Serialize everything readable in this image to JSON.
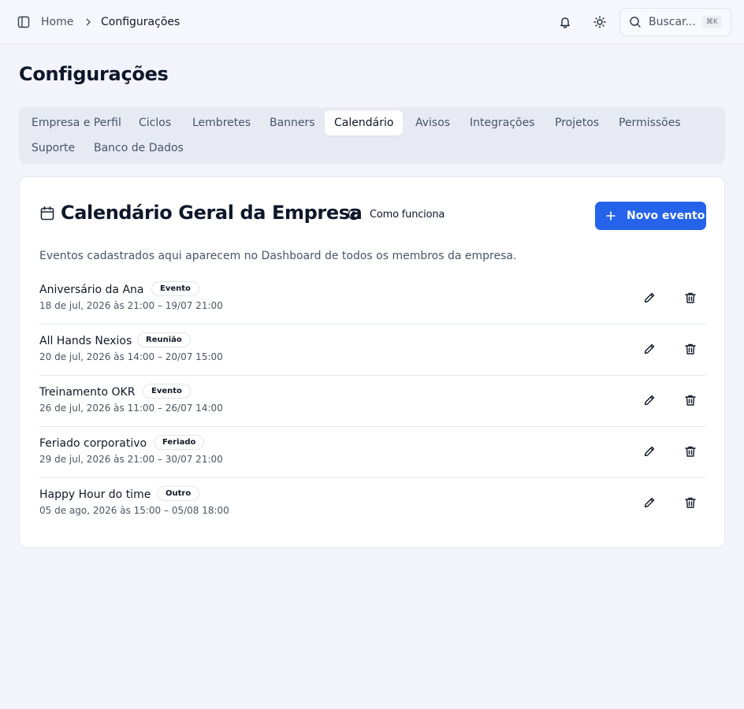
{
  "breadcrumb": {
    "home": "Home",
    "current": "Configurações"
  },
  "search": {
    "label": "Buscar...",
    "shortcut": "⌘K"
  },
  "page": {
    "title": "Configurações"
  },
  "tabs": [
    "Empresa e Perfil",
    "Ciclos",
    "Lembretes",
    "Banners",
    "Calendário",
    "Avisos",
    "Integrações",
    "Projetos",
    "Permissões",
    "Suporte",
    "Banco de Dados"
  ],
  "active_tab": "Calendário",
  "card": {
    "title": "Calendário Geral da Empresa",
    "how_label": "Como funciona",
    "new_button": "Novo evento",
    "description": "Eventos cadastrados aqui aparecem no Dashboard de todos os membros da empresa."
  },
  "events": [
    {
      "title": "Aniversário da Ana",
      "badge": "Evento",
      "date": "18 de jul, 2026 às 21:00 – 19/07 21:00"
    },
    {
      "title": "All Hands Nexios",
      "badge": "Reunião",
      "date": "20 de jul, 2026 às 14:00 – 20/07 15:00"
    },
    {
      "title": "Treinamento OKR",
      "badge": "Evento",
      "date": "26 de jul, 2026 às 11:00 – 26/07 14:00"
    },
    {
      "title": "Feriado corporativo",
      "badge": "Feriado",
      "date": "29 de jul, 2026 às 21:00 – 30/07 21:00"
    },
    {
      "title": "Happy Hour do time",
      "badge": "Outro",
      "date": "05 de ago, 2026 às 15:00 – 05/08 18:00"
    }
  ],
  "colors": {
    "accent": "#2563eb",
    "background": "#f3f4fb",
    "text": "#0f172a"
  },
  "icons": [
    "sidebar-toggle-icon",
    "chevron-right-icon",
    "bell-icon",
    "sun-icon",
    "search-icon",
    "calendar-icon",
    "help-circle-icon",
    "plus-icon",
    "pencil-icon",
    "trash-icon"
  ]
}
